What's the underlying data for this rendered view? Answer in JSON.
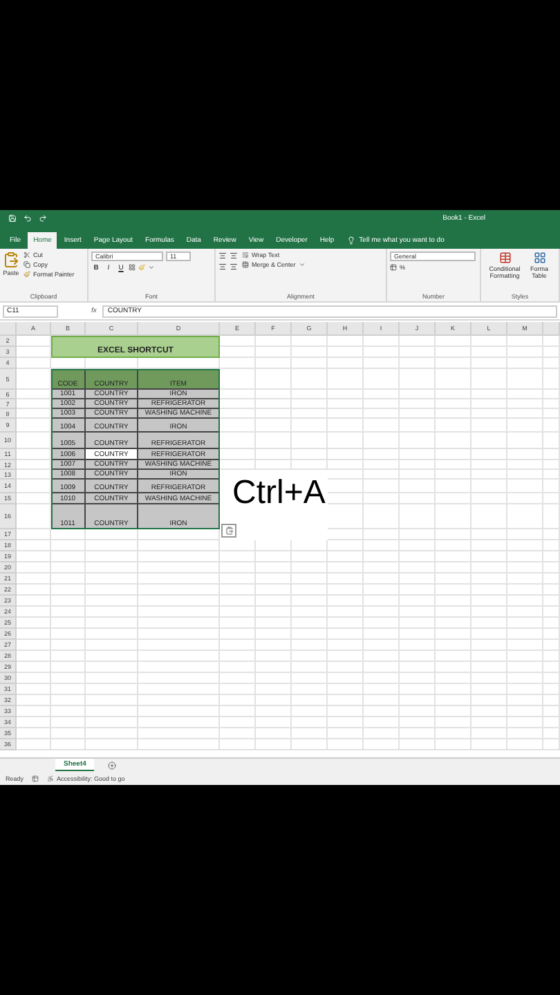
{
  "title_bar": {
    "title": "Book1 - Excel"
  },
  "tabs": [
    {
      "label": "File",
      "selected": false
    },
    {
      "label": "Home",
      "selected": true
    },
    {
      "label": "Insert",
      "selected": false
    },
    {
      "label": "Page Layout",
      "selected": false
    },
    {
      "label": "Formulas",
      "selected": false
    },
    {
      "label": "Data",
      "selected": false
    },
    {
      "label": "Review",
      "selected": false
    },
    {
      "label": "View",
      "selected": false
    },
    {
      "label": "Developer",
      "selected": false
    },
    {
      "label": "Help",
      "selected": false
    }
  ],
  "tell_me": {
    "placeholder": "Tell me what you want to do"
  },
  "clipboard": {
    "label": "Clipboard",
    "paste": "Paste",
    "cut": "Cut",
    "copy": "Copy",
    "format_painter": "Format Painter"
  },
  "font": {
    "label": "Font",
    "name": "Calibri",
    "size": "11",
    "bold": "B",
    "italic": "I",
    "underline": "U"
  },
  "alignment": {
    "label": "Alignment",
    "wrap_text": "Wrap Text",
    "merge_center": "Merge & Center"
  },
  "number": {
    "label": "Number",
    "format": "General",
    "percent": "%"
  },
  "styles": {
    "label": "Styles",
    "conditional_formatting": "Conditional Formatting",
    "format_table": "Forma Table"
  },
  "formula_bar": {
    "name_box": "C11",
    "fx": "fx",
    "value": "COUNTRY"
  },
  "columns": [
    "A",
    "B",
    "C",
    "D",
    "E",
    "F",
    "G",
    "H",
    "I",
    "J",
    "K",
    "L",
    "M"
  ],
  "row_numbers": [
    "2",
    "3",
    "4",
    "5",
    "6",
    "7",
    "8",
    "9",
    "10",
    "11",
    "12",
    "13",
    "14",
    "15",
    "16",
    "17",
    "18",
    "19",
    "20",
    "21",
    "22",
    "23",
    "24",
    "25",
    "26",
    "27",
    "28",
    "29",
    "30",
    "31",
    "32",
    "33",
    "34",
    "35",
    "36"
  ],
  "sheet_title": "EXCEL SHORTCUT",
  "table": {
    "selected": true,
    "columns": [
      "CODE",
      "COUNTRY",
      "ITEM"
    ],
    "rows": [
      {
        "cells": [
          "1001",
          "COUNTRY",
          "IRON"
        ],
        "active": false
      },
      {
        "cells": [
          "1002",
          "COUNTRY",
          "REFRIGERATOR"
        ],
        "active": false
      },
      {
        "cells": [
          "1003",
          "COUNTRY",
          "WASHING MACHINE"
        ],
        "active": false
      },
      {
        "cells": [
          "1004",
          "COUNTRY",
          "IRON"
        ],
        "active": false
      },
      {
        "cells": [
          "1005",
          "COUNTRY",
          "REFRIGERATOR"
        ],
        "active": false
      },
      {
        "cells": [
          "1006",
          "COUNTRY",
          "REFRIGERATOR"
        ],
        "active": true
      },
      {
        "cells": [
          "1007",
          "COUNTRY",
          "WASHING MACHINE"
        ],
        "active": false
      },
      {
        "cells": [
          "1008",
          "COUNTRY",
          "IRON"
        ],
        "active": false
      },
      {
        "cells": [
          "1009",
          "COUNTRY",
          "REFRIGERATOR"
        ],
        "active": false
      },
      {
        "cells": [
          "1010",
          "COUNTRY",
          "WASHING MACHINE"
        ],
        "active": false
      },
      {
        "cells": [
          "1011",
          "COUNTRY",
          "IRON"
        ],
        "active": false
      }
    ]
  },
  "caption": "Ctrl+A",
  "sheet_tabs": [
    {
      "label": "Sheet4",
      "selected": true
    }
  ],
  "status_bar": {
    "mode": "Ready",
    "accessibility": "Accessibility: Good to go"
  }
}
